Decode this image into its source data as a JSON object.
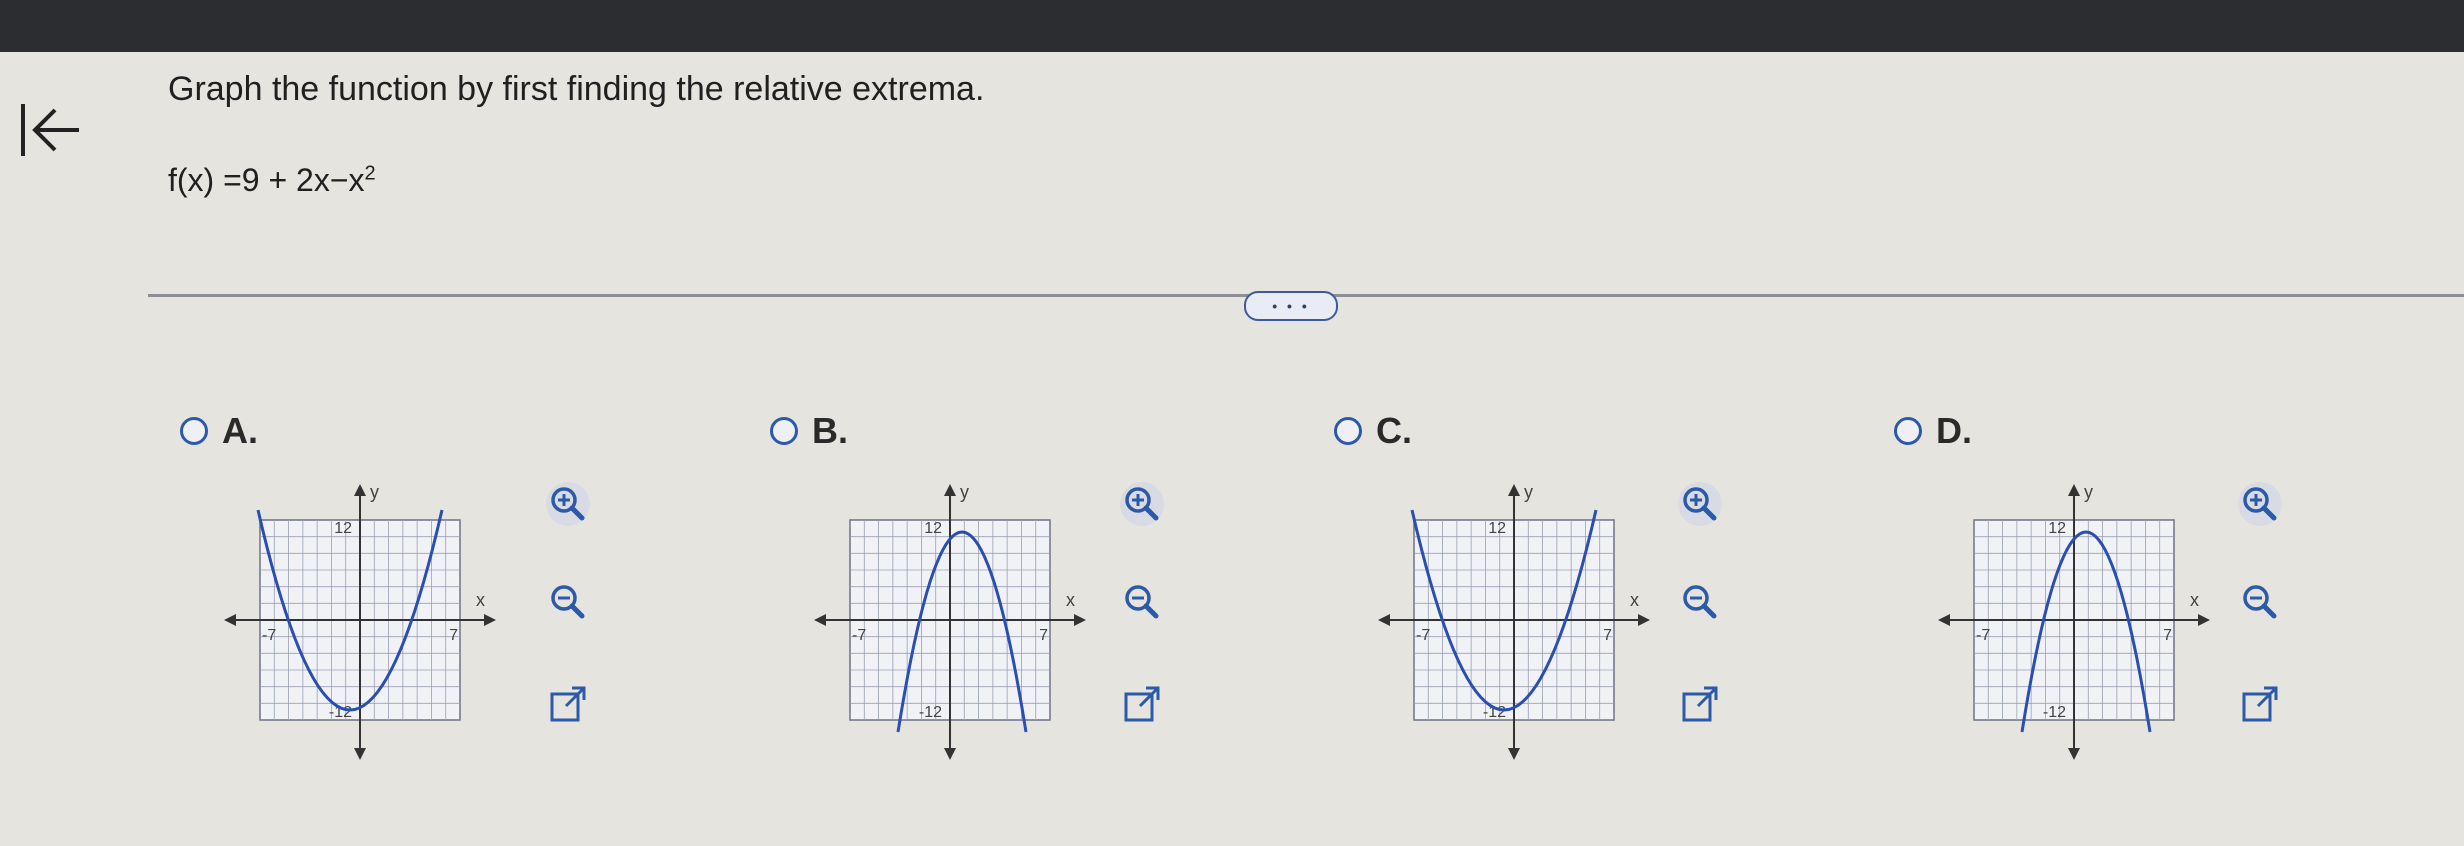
{
  "question": {
    "title": "Graph the function by first finding the relative extrema.",
    "function_prefix": "f(x) =9 + 2x−x",
    "function_exponent": "2"
  },
  "more_button": "• • •",
  "options": [
    {
      "letter": "A.",
      "shape": "upward",
      "y_tick": "12",
      "x_label": "x",
      "y_label": "y",
      "x_left": "-7",
      "x_right": "7",
      "y_bottom": "-12"
    },
    {
      "letter": "B.",
      "shape": "downward",
      "y_tick": "12",
      "x_label": "x",
      "y_label": "y",
      "x_left": "-7",
      "x_right": "7",
      "y_bottom": "-12"
    },
    {
      "letter": "C.",
      "shape": "upward",
      "y_tick": "12",
      "x_label": "x",
      "y_label": "y",
      "x_left": "-7",
      "x_right": "7",
      "y_bottom": "-12"
    },
    {
      "letter": "D.",
      "shape": "downward",
      "y_tick": "12",
      "x_label": "x",
      "y_label": "y",
      "x_left": "-7",
      "x_right": "7",
      "y_bottom": "-12"
    }
  ],
  "tools": {
    "zoom_in": "zoom-in-icon",
    "zoom_out": "zoom-out-icon",
    "open": "open-new-window-icon"
  },
  "colors": {
    "curve": "#2a4fb0",
    "radio": "#2c5aa8",
    "grid": "#9aa0b4"
  }
}
